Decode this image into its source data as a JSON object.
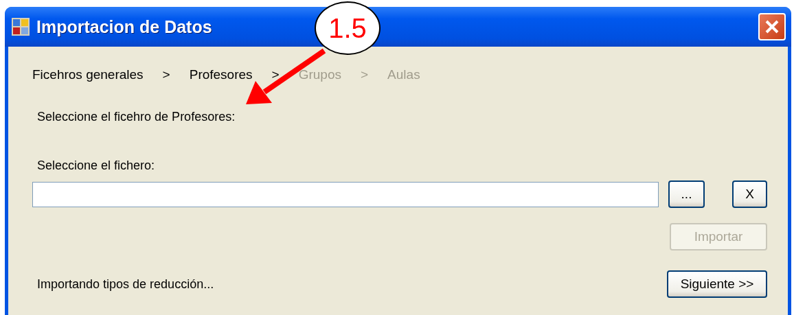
{
  "window": {
    "title": "Importacion de Datos"
  },
  "breadcrumb": [
    {
      "kind": "step",
      "label": "Ficehros generales",
      "disabled": false
    },
    {
      "kind": "separator",
      "label": ">",
      "disabled": false
    },
    {
      "kind": "step",
      "label": "Profesores",
      "disabled": false
    },
    {
      "kind": "separator",
      "label": ">",
      "disabled": false
    },
    {
      "kind": "step",
      "label": "Grupos",
      "disabled": true
    },
    {
      "kind": "separator",
      "label": ">",
      "disabled": true
    },
    {
      "kind": "step",
      "label": "Aulas",
      "disabled": true
    }
  ],
  "heading": "Seleccione el ficehro de Profesores:",
  "file_label": "Seleccione el fichero:",
  "browse_button": {
    "label": "...",
    "disabled": false
  },
  "clear_button": {
    "label": "X",
    "disabled": false
  },
  "import_button": {
    "label": "Importar",
    "disabled": true
  },
  "status": "Importando tipos de reducción...",
  "next_button": {
    "label": "Siguiente >>",
    "disabled": false
  },
  "callout": {
    "label": "1.5"
  }
}
